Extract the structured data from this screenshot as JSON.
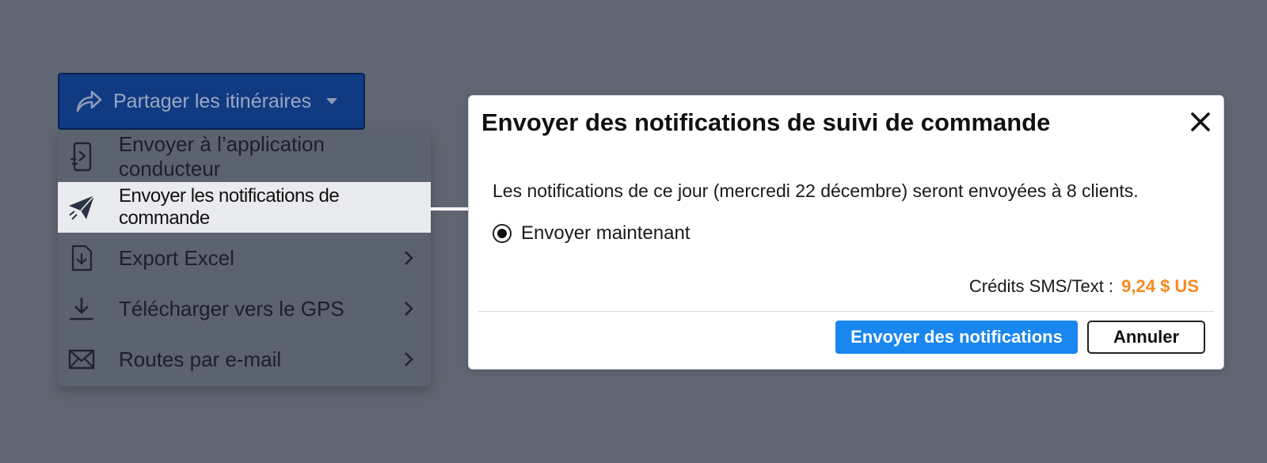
{
  "share_button": {
    "label": "Partager les itinéraires",
    "icon": "share-arrow-icon",
    "caret_icon": "caret-down-icon"
  },
  "menu": {
    "items": [
      {
        "label": "Envoyer à l’application conducteur",
        "icon": "phone-send-icon",
        "active": false,
        "submenu": false
      },
      {
        "label": "Envoyer les notifications de commande",
        "icon": "paper-plane-icon",
        "active": true,
        "submenu": false
      },
      {
        "label": "Export Excel",
        "icon": "file-download-icon",
        "active": false,
        "submenu": true
      },
      {
        "label": "Télécharger vers le GPS",
        "icon": "download-icon",
        "active": false,
        "submenu": true
      },
      {
        "label": "Routes par e-mail",
        "icon": "envelope-icon",
        "active": false,
        "submenu": true
      }
    ]
  },
  "dialog": {
    "title": "Envoyer des notifications de suivi de commande",
    "message": "Les notifications de ce jour (mercredi 22 décembre) seront envoyées à 8 clients.",
    "radio_label": "Envoyer maintenant",
    "radio_selected": true,
    "credits_label": "Crédits SMS/Text :",
    "credits_amount": "9,24 $ US",
    "primary_button": "Envoyer des notifications",
    "cancel_button": "Annuler"
  },
  "colors": {
    "background": "#5f6672",
    "share_button": "#103a82",
    "primary": "#1a86ef",
    "credits_amount": "#f58a1f"
  }
}
